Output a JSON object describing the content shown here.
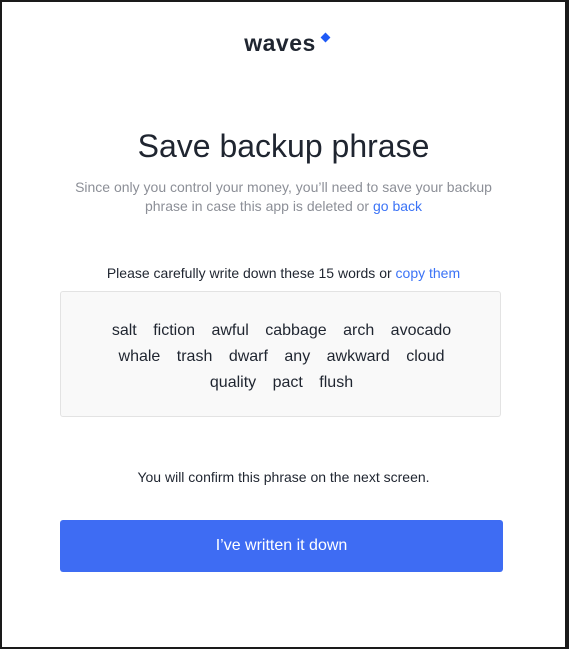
{
  "header": {
    "logo_text": "waves",
    "logo_accent_color": "#1f5af6"
  },
  "page": {
    "title": "Save backup phrase",
    "subtitle_text": "Since only you control your money, you’ll need to save your backup phrase in case this app is deleted or ",
    "subtitle_link": "go back",
    "instruction_text": "Please carefully write down these 15 words or ",
    "instruction_link": "copy them",
    "confirm_note": "You will confirm this phrase on the next screen.",
    "primary_button_label": "I’ve written it down",
    "link_color": "#3b73f6",
    "button_color": "#3e6cf3"
  },
  "phrase": {
    "words": [
      "salt",
      "fiction",
      "awful",
      "cabbage",
      "arch",
      "avocado",
      "whale",
      "trash",
      "dwarf",
      "any",
      "awkward",
      "cloud",
      "quality",
      "pact",
      "flush"
    ]
  }
}
